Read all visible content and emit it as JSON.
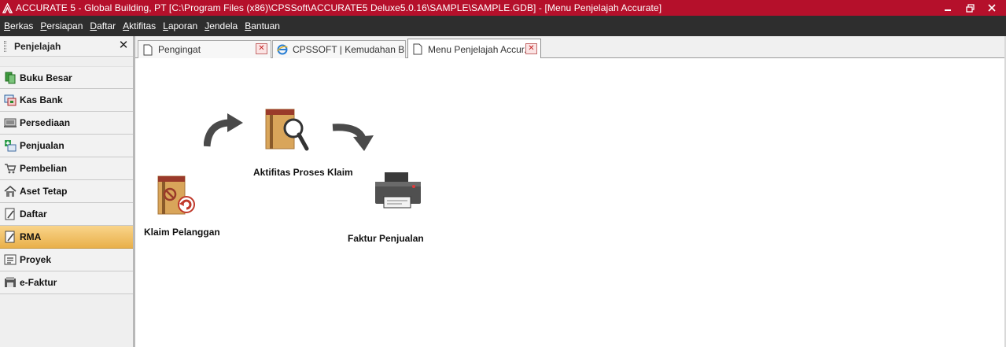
{
  "window": {
    "title": "ACCURATE 5  - Global Building, PT  [C:\\Program Files (x86)\\CPSSoft\\ACCURATE5 Deluxe5.0.16\\SAMPLE\\SAMPLE.GDB] - [Menu Penjelajah Accurate]",
    "controls": {
      "minimize": "–",
      "restore": "❐",
      "close": "✕"
    }
  },
  "menu": {
    "items": [
      {
        "underline": "B",
        "rest": "erkas"
      },
      {
        "underline": "P",
        "rest": "ersiapan"
      },
      {
        "underline": "D",
        "rest": "aftar"
      },
      {
        "underline": "A",
        "rest": "ktifitas"
      },
      {
        "underline": "L",
        "rest": "aporan"
      },
      {
        "underline": "J",
        "rest": "endela"
      },
      {
        "underline": "B",
        "rest": "antuan"
      }
    ]
  },
  "sidebar": {
    "title": "Penjelajah",
    "close": "✕",
    "items": [
      {
        "label": "Buku Besar",
        "icon": "ledger-icon"
      },
      {
        "label": "Kas Bank",
        "icon": "cash-bank-icon"
      },
      {
        "label": "Persediaan",
        "icon": "inventory-icon"
      },
      {
        "label": "Penjualan",
        "icon": "sales-icon"
      },
      {
        "label": "Pembelian",
        "icon": "cart-icon"
      },
      {
        "label": "Aset Tetap",
        "icon": "house-icon"
      },
      {
        "label": "Daftar",
        "icon": "list-icon"
      },
      {
        "label": "RMA",
        "icon": "rma-icon",
        "active": true
      },
      {
        "label": "Proyek",
        "icon": "project-icon"
      },
      {
        "label": "e-Faktur",
        "icon": "efaktur-icon"
      }
    ]
  },
  "tabs": [
    {
      "label": "Pengingat",
      "icon": "document-icon",
      "close": "✕"
    },
    {
      "label": "CPSSOFT | Kemudahan Bis...",
      "icon": "ie-icon",
      "close": "✕"
    },
    {
      "label": "Menu Penjelajah Accur...",
      "icon": "document-icon",
      "close": "✕",
      "active": true
    }
  ],
  "diagram": {
    "nodes": [
      {
        "label": "Klaim Pelanggan",
        "icon": "customer-claim-icon"
      },
      {
        "label": "Aktifitas Proses Klaim",
        "icon": "claim-process-icon"
      },
      {
        "label": "Faktur Penjualan",
        "icon": "printer-icon"
      }
    ],
    "colors": {
      "accent": "#b5102b",
      "arrow": "#444444",
      "folder": "#d9a55a",
      "active": "#f0c060"
    }
  }
}
